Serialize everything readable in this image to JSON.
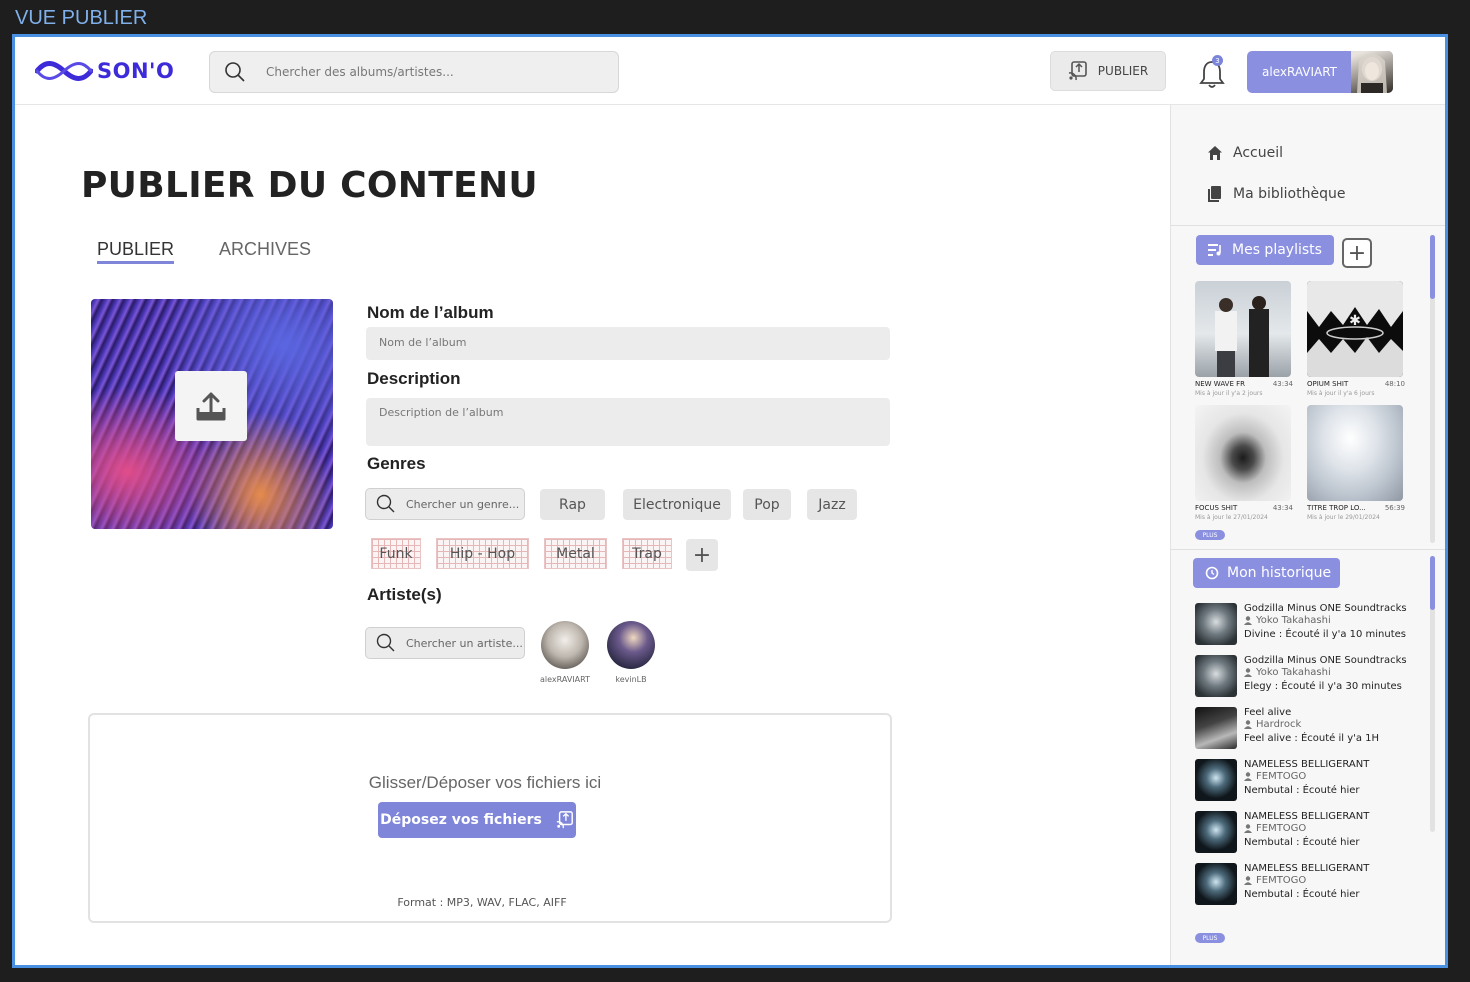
{
  "frame_label": "VUE PUBLIER",
  "header": {
    "logo_text": "SON'O",
    "search_placeholder": "Chercher des albums/artistes...",
    "publish_label": "PUBLIER",
    "notifications_count": "3",
    "username": "alexRAVIART"
  },
  "page": {
    "title": "PUBLIER DU CONTENU",
    "tabs": [
      {
        "label": "PUBLIER",
        "active": true
      },
      {
        "label": "ARCHIVES",
        "active": false
      }
    ]
  },
  "form": {
    "album_name_label": "Nom de l’album",
    "album_name_placeholder": "Nom de l’album",
    "description_label": "Description",
    "description_placeholder": "Description de l’album",
    "genres_label": "Genres",
    "genre_search_placeholder": "Chercher un genre...",
    "genres": [
      "Rap",
      "Electronique",
      "Pop",
      "Jazz"
    ],
    "genres_selected": [
      "Funk",
      "Hip - Hop",
      "Metal",
      "Trap"
    ],
    "add_genre_label": "+",
    "artists_label": "Artiste(s)",
    "artist_search_placeholder": "Chercher un artiste...",
    "artists": [
      {
        "name": "alexRAVIART"
      },
      {
        "name": "kevinLB"
      }
    ]
  },
  "dropzone": {
    "text": "Glisser/Déposer vos fichiers ici",
    "button_label": "Déposez vos fichiers",
    "formats": "Format : MP3, WAV, FLAC, AIFF"
  },
  "sidebar": {
    "nav": [
      {
        "label": "Accueil",
        "icon": "home-icon"
      },
      {
        "label": "Ma bibliothèque",
        "icon": "library-icon"
      }
    ],
    "playlists_label": "Mes playlists",
    "add_playlist_label": "+",
    "playlists": [
      {
        "title": "NEW WAVE FR",
        "duration": "43:34",
        "updated": "Mis à jour il y'a 2 jours"
      },
      {
        "title": "OPIUM SHIT",
        "duration": "48:10",
        "updated": "Mis à jour il y'a 6 jours"
      },
      {
        "title": "FOCUS SHIT",
        "duration": "43:34",
        "updated": "Mis à jour le 27/01/2024"
      },
      {
        "title": "TITRE TROP LO...",
        "duration": "56:39",
        "updated": "Mis à jour le 29/01/2024"
      }
    ],
    "more_label": "PLUS",
    "history_label": "Mon historique",
    "history": [
      {
        "title": "Godzilla Minus ONE Soundtracks",
        "artist": "Yoko Takahashi",
        "listened": "Divine : Écouté il y'a 10 minutes"
      },
      {
        "title": "Godzilla Minus ONE Soundtracks",
        "artist": "Yoko Takahashi",
        "listened": "Elegy : Écouté il y'a 30 minutes"
      },
      {
        "title": "Feel alive",
        "artist": "Hardrock",
        "listened": "Feel alive : Écouté il y'a 1H"
      },
      {
        "title": "NAMELESS BELLIGERANT",
        "artist": "FEMTOGO",
        "listened": "Nembutal : Écouté hier"
      },
      {
        "title": "NAMELESS BELLIGERANT",
        "artist": "FEMTOGO",
        "listened": "Nembutal : Écouté hier"
      },
      {
        "title": "NAMELESS BELLIGERANT",
        "artist": "FEMTOGO",
        "listened": "Nembutal : Écouté hier"
      }
    ],
    "history_more_label": "PLUS"
  },
  "colors": {
    "accent": "#8a8fe0",
    "brand": "#3d2bd9",
    "frame_border": "#4a90e2"
  }
}
